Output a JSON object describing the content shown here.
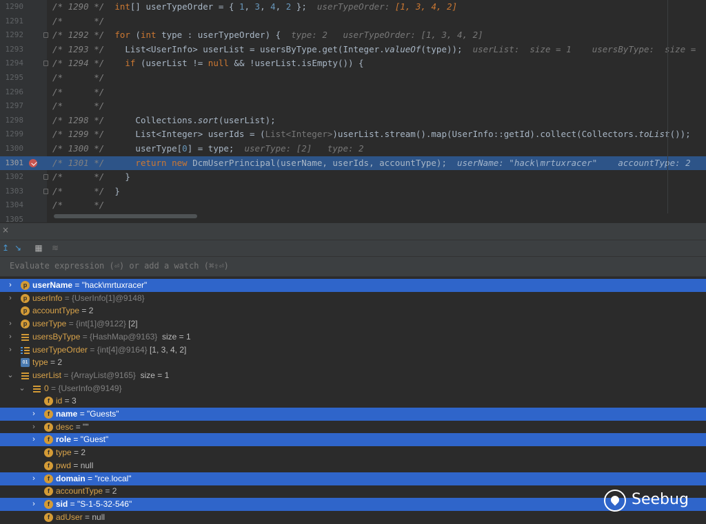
{
  "editor": {
    "lines": [
      {
        "ln": "1290",
        "cm": "/* 1290 */",
        "fold": false,
        "bp": false,
        "hl": false,
        "segs": [
          [
            "plain",
            "  "
          ],
          [
            "kw",
            "int"
          ],
          [
            "plain",
            "[] userTypeOrder = { "
          ],
          [
            "num",
            "1"
          ],
          [
            "plain",
            ", "
          ],
          [
            "num",
            "3"
          ],
          [
            "plain",
            ", "
          ],
          [
            "num",
            "4"
          ],
          [
            "plain",
            ", "
          ],
          [
            "num",
            "2"
          ],
          [
            "plain",
            " };"
          ]
        ],
        "hint": [
          [
            "h",
            "  userTypeOrder: "
          ],
          [
            "v",
            "[1, 3, 4, 2]"
          ]
        ]
      },
      {
        "ln": "1291",
        "cm": "/*      */",
        "fold": false,
        "bp": false,
        "hl": false,
        "segs": [],
        "hint": []
      },
      {
        "ln": "1292",
        "cm": "/* 1292 */",
        "fold": true,
        "bp": false,
        "hl": false,
        "segs": [
          [
            "plain",
            "  "
          ],
          [
            "kw",
            "for"
          ],
          [
            "plain",
            " ("
          ],
          [
            "kw",
            "int"
          ],
          [
            "plain",
            " type : userTypeOrder) {"
          ]
        ],
        "hint": [
          [
            "h",
            "  type: 2   userTypeOrder: [1, 3, 4, 2]"
          ]
        ]
      },
      {
        "ln": "1293",
        "cm": "/* 1293 */",
        "fold": false,
        "bp": false,
        "hl": false,
        "segs": [
          [
            "plain",
            "    List<UserInfo> userList = usersByType.get(Integer."
          ],
          [
            "fn",
            "valueOf"
          ],
          [
            "plain",
            "(type));"
          ]
        ],
        "hint": [
          [
            "h",
            "  userList:  size = 1    usersByType:  size ="
          ]
        ]
      },
      {
        "ln": "1294",
        "cm": "/* 1294 */",
        "fold": true,
        "bp": false,
        "hl": false,
        "segs": [
          [
            "plain",
            "    "
          ],
          [
            "kw",
            "if"
          ],
          [
            "plain",
            " (userList != "
          ],
          [
            "kw",
            "null"
          ],
          [
            "plain",
            " && !userList.isEmpty()) {"
          ]
        ],
        "hint": []
      },
      {
        "ln": "1295",
        "cm": "/*      */",
        "fold": false,
        "bp": false,
        "hl": false,
        "segs": [],
        "hint": []
      },
      {
        "ln": "1296",
        "cm": "/*      */",
        "fold": false,
        "bp": false,
        "hl": false,
        "segs": [],
        "hint": []
      },
      {
        "ln": "1297",
        "cm": "/*      */",
        "fold": false,
        "bp": false,
        "hl": false,
        "segs": [],
        "hint": []
      },
      {
        "ln": "1298",
        "cm": "/* 1298 */",
        "fold": false,
        "bp": false,
        "hl": false,
        "segs": [
          [
            "plain",
            "      Collections."
          ],
          [
            "fn",
            "sort"
          ],
          [
            "plain",
            "(userList);"
          ]
        ],
        "hint": []
      },
      {
        "ln": "1299",
        "cm": "/* 1299 */",
        "fold": false,
        "bp": false,
        "hl": false,
        "segs": [
          [
            "plain",
            "      List<Integer> userIds = ("
          ],
          [
            "gray",
            "List<Integer>"
          ],
          [
            "plain",
            ")userList.stream().map(UserInfo::getId).collect(Collectors."
          ],
          [
            "fn",
            "toList"
          ],
          [
            "plain",
            "());"
          ]
        ],
        "hint": []
      },
      {
        "ln": "1300",
        "cm": "/* 1300 */",
        "fold": false,
        "bp": false,
        "hl": false,
        "segs": [
          [
            "plain",
            "      userType["
          ],
          [
            "num",
            "0"
          ],
          [
            "plain",
            "] = type;"
          ]
        ],
        "hint": [
          [
            "h",
            "  userType: [2]   type: 2"
          ]
        ]
      },
      {
        "ln": "1301",
        "cm": "/* 1301 */",
        "fold": false,
        "bp": true,
        "hl": true,
        "segs": [
          [
            "plain",
            "      "
          ],
          [
            "kw",
            "return new"
          ],
          [
            "plain",
            " DcmUserPrincipal(userName, userIds, accountType);"
          ]
        ],
        "hint": [
          [
            "h",
            "  userName: \"hack\\mrtuxracer\"    accountType: 2"
          ]
        ]
      },
      {
        "ln": "1302",
        "cm": "/*      */",
        "fold": true,
        "bp": false,
        "hl": false,
        "segs": [
          [
            "plain",
            "    }"
          ]
        ],
        "hint": []
      },
      {
        "ln": "1303",
        "cm": "/*      */",
        "fold": true,
        "bp": false,
        "hl": false,
        "segs": [
          [
            "plain",
            "  }"
          ]
        ],
        "hint": []
      },
      {
        "ln": "1304",
        "cm": "/*      */",
        "fold": false,
        "bp": false,
        "hl": false,
        "segs": [],
        "hint": []
      },
      {
        "ln": "1305",
        "cm": "",
        "fold": false,
        "bp": false,
        "hl": false,
        "segs": [],
        "hint": []
      }
    ]
  },
  "debug": {
    "close_glyph": "×",
    "eval_placeholder": "Evaluate expression (⏎) or add a watch (⌘⇧⏎)"
  },
  "variables": [
    {
      "indent": 0,
      "arrow": "›",
      "icon": "p",
      "sel": true,
      "name": "userName",
      "rest": " = \"hack\\mrtuxracer\""
    },
    {
      "indent": 0,
      "arrow": "›",
      "icon": "p",
      "sel": false,
      "name": "userInfo",
      "ref": " = {UserInfo[1]@9148}",
      "rest": ""
    },
    {
      "indent": 0,
      "arrow": "",
      "icon": "p",
      "sel": false,
      "name": "accountType",
      "rest": " = 2"
    },
    {
      "indent": 0,
      "arrow": "›",
      "icon": "p",
      "sel": false,
      "name": "userType",
      "ref": " = {int[1]@9122}",
      "rest": " [2]"
    },
    {
      "indent": 0,
      "arrow": "›",
      "icon": "lst",
      "sel": false,
      "name": "usersByType",
      "ref": " = {HashMap@9163}",
      "rest": "  size = 1"
    },
    {
      "indent": 0,
      "arrow": "›",
      "icon": "arr",
      "sel": false,
      "name": "userTypeOrder",
      "ref": " = {int[4]@9164}",
      "rest": " [1, 3, 4, 2]"
    },
    {
      "indent": 0,
      "arrow": "",
      "icon": "prim",
      "sel": false,
      "name": "type",
      "rest": " = 2"
    },
    {
      "indent": 0,
      "arrow": "⌄",
      "icon": "lst",
      "sel": false,
      "name": "userList",
      "ref": " = {ArrayList@9165}",
      "rest": "  size = 1"
    },
    {
      "indent": 1,
      "arrow": "⌄",
      "icon": "lst",
      "sel": false,
      "name": "0",
      "ref": " = {UserInfo@9149}",
      "rest": ""
    },
    {
      "indent": 2,
      "arrow": "",
      "icon": "f",
      "sel": false,
      "name": "id",
      "rest": " = 3"
    },
    {
      "indent": 2,
      "arrow": "›",
      "icon": "f",
      "sel": true,
      "name": "name",
      "rest": " = \"Guests\""
    },
    {
      "indent": 2,
      "arrow": "›",
      "icon": "f",
      "sel": false,
      "name": "desc",
      "rest": " = \"\""
    },
    {
      "indent": 2,
      "arrow": "›",
      "icon": "f",
      "sel": true,
      "name": "role",
      "rest": " = \"Guest\""
    },
    {
      "indent": 2,
      "arrow": "",
      "icon": "f",
      "sel": false,
      "name": "type",
      "rest": " = 2"
    },
    {
      "indent": 2,
      "arrow": "",
      "icon": "f",
      "sel": false,
      "name": "pwd",
      "rest": " = null"
    },
    {
      "indent": 2,
      "arrow": "›",
      "icon": "f",
      "sel": true,
      "name": "domain",
      "rest": " = \"rce.local\""
    },
    {
      "indent": 2,
      "arrow": "",
      "icon": "f",
      "sel": false,
      "name": "accountType",
      "rest": " = 2"
    },
    {
      "indent": 2,
      "arrow": "›",
      "icon": "f",
      "sel": true,
      "name": "sid",
      "rest": " = \"S-1-5-32-546\""
    },
    {
      "indent": 2,
      "arrow": "",
      "icon": "f",
      "sel": false,
      "name": "adUser",
      "rest": " = null"
    }
  ],
  "watermark": {
    "text": "Seebug"
  },
  "colors": {
    "selection": "#2f65ca",
    "current_line": "#2d5488",
    "keyword": "#cc7832",
    "number": "#6897bb"
  }
}
